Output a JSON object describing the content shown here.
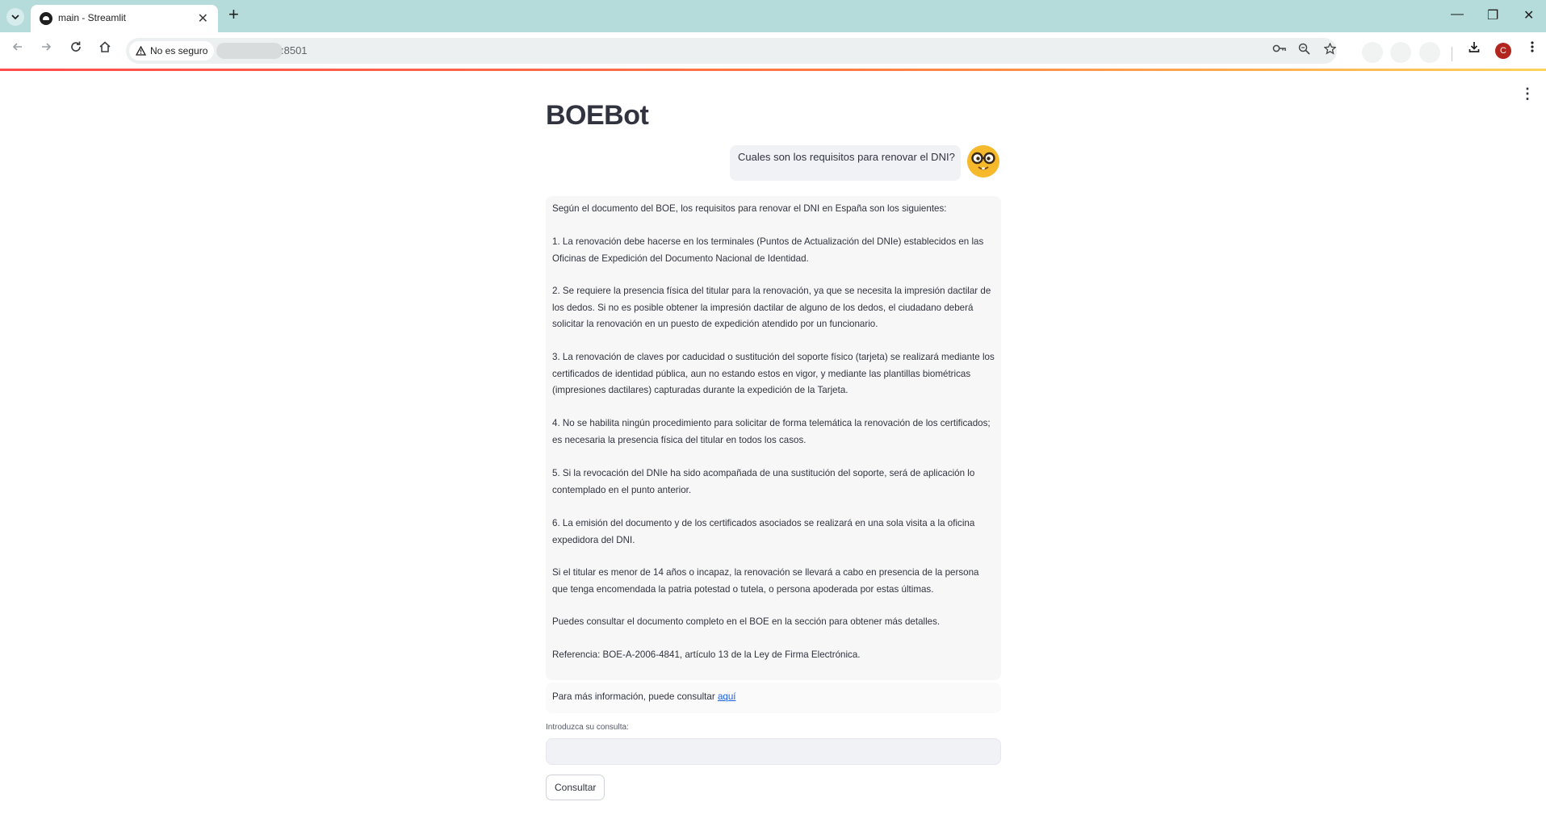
{
  "browser": {
    "tab_title": "main - Streamlit",
    "tab_close": "✕",
    "new_tab": "+",
    "security_label": "No es seguro",
    "url_port": ":8501",
    "profile_initial": "C",
    "window": {
      "minimize": "—",
      "restore": "❐",
      "close": "✕"
    }
  },
  "app": {
    "title": "BOEBot",
    "menu": "⋮",
    "chat": {
      "user_message": "Cuales son los requisitos para renovar el DNI?",
      "assistant_paragraphs": [
        "Según el documento del BOE, los requisitos para renovar el DNI en España son los siguientes:",
        "1. La renovación debe hacerse en los terminales (Puntos de Actualización del DNIe) establecidos en las Oficinas de Expedición del Documento Nacional de Identidad.",
        "2. Se requiere la presencia física del titular para la renovación, ya que se necesita la impresión dactilar de los dedos. Si no es posible obtener la impresión dactilar de alguno de los dedos, el ciudadano deberá solicitar la renovación en un puesto de expedición atendido por un funcionario.",
        "3. La renovación de claves por caducidad o sustitución del soporte físico (tarjeta) se realizará mediante los certificados de identidad pública, aun no estando estos en vigor, y mediante las plantillas biométricas (impresiones dactilares) capturadas durante la expedición de la Tarjeta.",
        "4. No se habilita ningún procedimiento para solicitar de forma telemática la renovación de los certificados; es necesaria la presencia física del titular en todos los casos.",
        "5. Si la revocación del DNIe ha sido acompañada de una sustitución del soporte, será de aplicación lo contemplado en el punto anterior.",
        "6. La emisión del documento y de los certificados asociados se realizará en una sola visita a la oficina expedidora del DNI.",
        "Si el titular es menor de 14 años o incapaz, la renovación se llevará a cabo en presencia de la persona que tenga encomendada la patria potestad o tutela, o persona apoderada por estas últimas.",
        "Puedes consultar el documento completo en el BOE en la sección para obtener más detalles.",
        "Referencia: BOE-A-2006-4841, artículo 13 de la Ley de Firma Electrónica."
      ],
      "more_info_text": "Para más información, puede consultar ",
      "more_info_link": "aquí"
    },
    "query": {
      "label": "Introduzca su consulta:",
      "value": "",
      "submit_label": "Consultar"
    }
  }
}
